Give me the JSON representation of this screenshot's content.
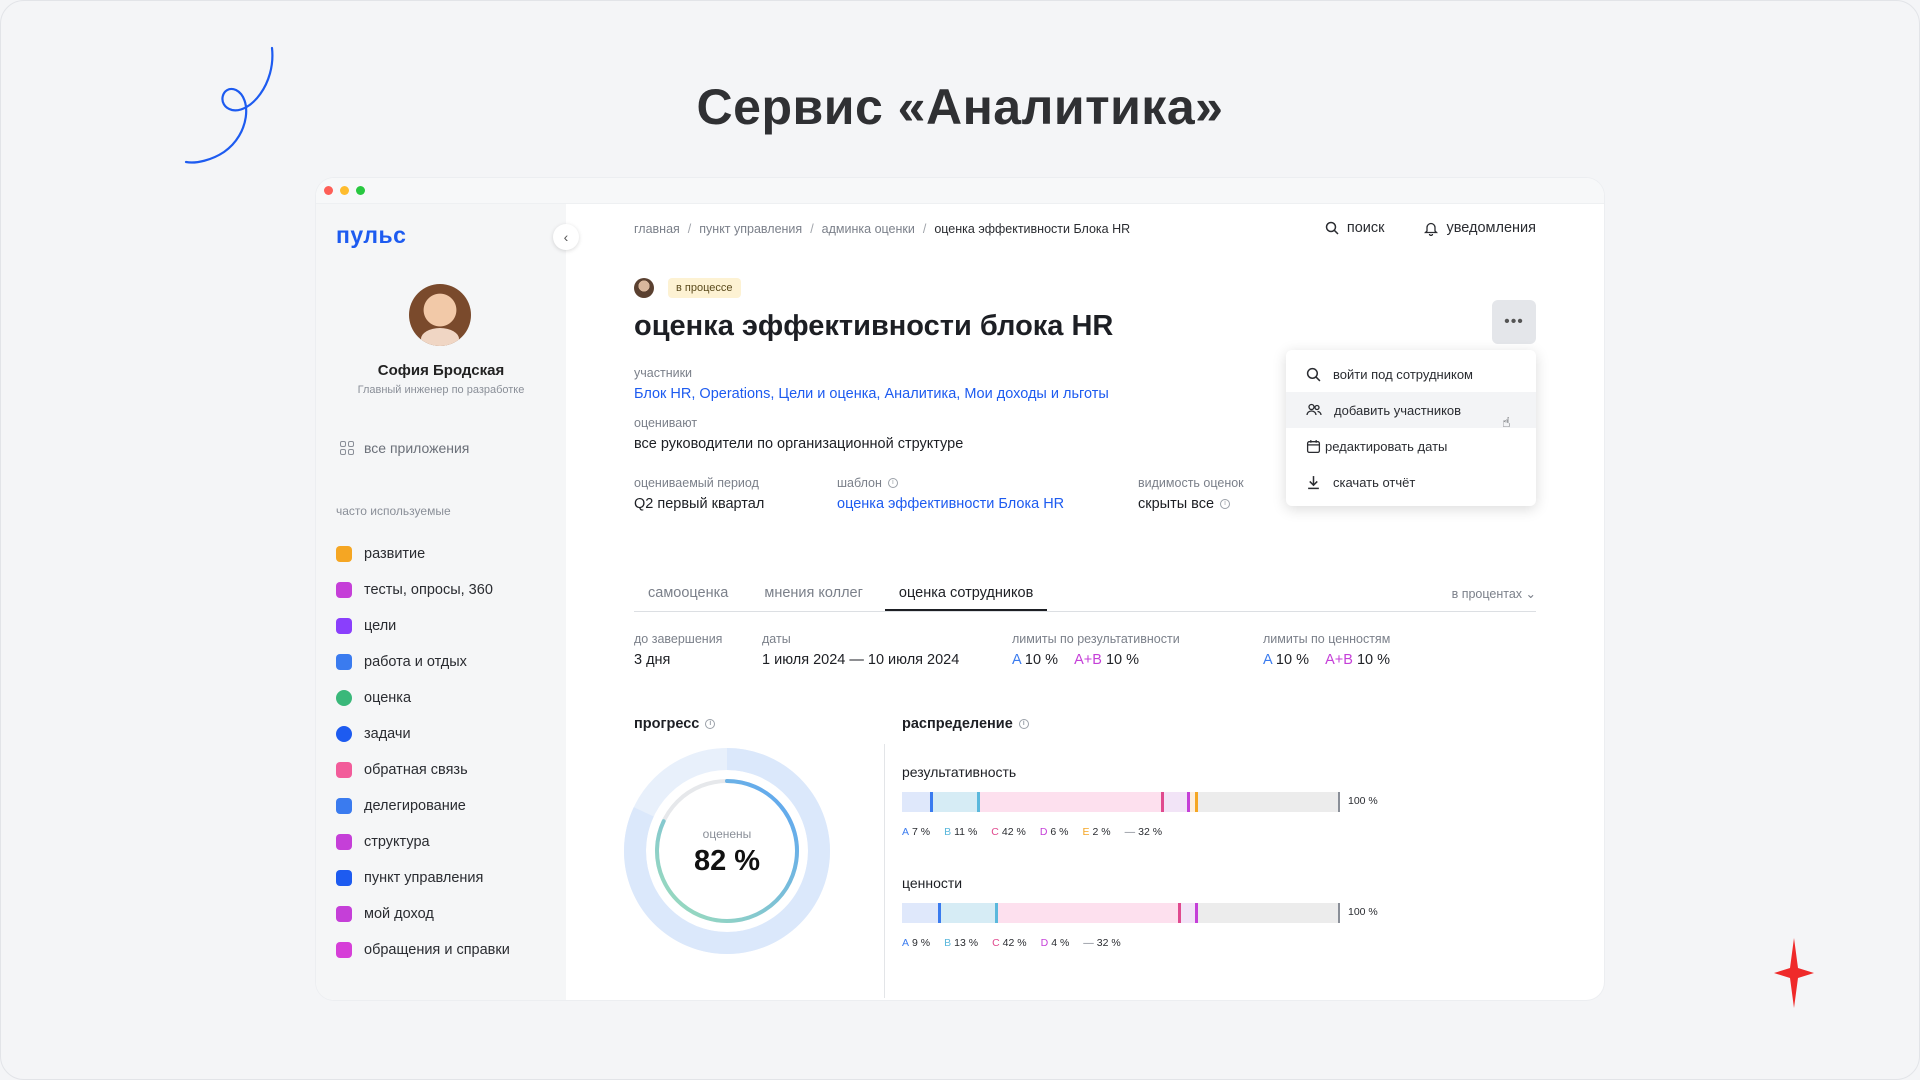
{
  "slide": {
    "title": "Сервис «Аналитика»"
  },
  "app": {
    "logo": "пульс",
    "user": {
      "name": "София Бродская",
      "role": "Главный инженер по разработке"
    },
    "all_apps": "все приложения",
    "frequent_label": "часто используемые",
    "nav": [
      {
        "label": "развитие",
        "icon": "book-icon",
        "color": "#f5a623"
      },
      {
        "label": "тесты, опросы, 360",
        "icon": "checkbox-icon",
        "color": "#c53fd8"
      },
      {
        "label": "цели",
        "icon": "flag-icon",
        "color": "#8a3ffc"
      },
      {
        "label": "работа и отдых",
        "icon": "chat-icon",
        "color": "#3a7bef"
      },
      {
        "label": "оценка",
        "icon": "star-circle-icon",
        "color": "#3ab87a"
      },
      {
        "label": "задачи",
        "icon": "target-icon",
        "color": "#1d5bf0"
      },
      {
        "label": "обратная связь",
        "icon": "feedback-icon",
        "color": "#f25c9a"
      },
      {
        "label": "делегирование",
        "icon": "people-icon",
        "color": "#3a7bef"
      },
      {
        "label": "структура",
        "icon": "structure-icon",
        "color": "#c53fd8"
      },
      {
        "label": "пункт управления",
        "icon": "wrench-icon",
        "color": "#1d5bf0"
      },
      {
        "label": "мой доход",
        "icon": "gem-icon",
        "color": "#c53fd8"
      },
      {
        "label": "обращения и справки",
        "icon": "document-icon",
        "color": "#d63fd8"
      }
    ]
  },
  "header": {
    "breadcrumb": [
      "главная",
      "пункт управления",
      "админка оценки",
      "оценка эффективности Блока HR"
    ],
    "search": "поиск",
    "notifications": "уведомления"
  },
  "page": {
    "status": "в процессе",
    "title": "оценка эффективности блока HR",
    "participants_label": "участники",
    "participants": "Блок HR, Operations, Цели и оценка, Аналитика, Мои доходы и льготы",
    "evaluators_label": "оценивают",
    "evaluators": "все руководители по организационной структуре",
    "period_label": "оцениваемый период",
    "period": "Q2 первый квартал",
    "template_label": "шаблон",
    "template": "оценка эффективности Блока HR",
    "visibility_label": "видимость оценок",
    "visibility": "скрыты все"
  },
  "menu": [
    {
      "label": "войти под сотрудником",
      "icon": "search-icon"
    },
    {
      "label": "добавить участников",
      "icon": "add-people-icon"
    },
    {
      "label": "редактировать даты",
      "icon": "calendar-icon"
    },
    {
      "label": "скачать отчёт",
      "icon": "download-icon"
    }
  ],
  "tabs": {
    "items": [
      "самооценка",
      "мнения коллег",
      "оценка сотрудников"
    ],
    "active": 2,
    "units": "в процентах"
  },
  "limits": {
    "remaining_label": "до завершения",
    "remaining": "3 дня",
    "dates_label": "даты",
    "dates": "1 июля 2024 — 10 июля 2024",
    "perf_label": "лимиты по результативности",
    "values_label": "лимиты по ценностям",
    "A_label": "A",
    "AB_label": "A+B",
    "perf_A": "10 %",
    "perf_AB": "10 %",
    "val_A": "10 %",
    "val_AB": "10 %"
  },
  "progress": {
    "heading": "прогресс",
    "caption": "оценены",
    "value_text": "82 %",
    "value": 82
  },
  "distribution": {
    "heading": "распределение",
    "total": "100 %",
    "colors": {
      "A": "#dfe8fb",
      "B": "#d6ecf5",
      "C": "#fde0ee",
      "D": "#f2e4f7",
      "E": "#fdeedd",
      "none": "#ececec"
    },
    "marks": {
      "A": "#3a7bef",
      "B": "#5bb8dc",
      "C": "#e04a8f",
      "D": "#c53fd8",
      "E": "#f5a623"
    },
    "groups": [
      {
        "name": "результативность",
        "segments": [
          {
            "key": "A",
            "label": "A",
            "text": "7 %",
            "value": 7
          },
          {
            "key": "B",
            "label": "B",
            "text": "11 %",
            "value": 11
          },
          {
            "key": "C",
            "label": "C",
            "text": "42 %",
            "value": 42
          },
          {
            "key": "D",
            "label": "D",
            "text": "6 %",
            "value": 6
          },
          {
            "key": "E",
            "label": "E",
            "text": "2 %",
            "value": 2
          },
          {
            "key": "none",
            "label": "—",
            "text": "32 %",
            "value": 32
          }
        ]
      },
      {
        "name": "ценности",
        "segments": [
          {
            "key": "A",
            "label": "A",
            "text": "9 %",
            "value": 9
          },
          {
            "key": "B",
            "label": "B",
            "text": "13 %",
            "value": 13
          },
          {
            "key": "C",
            "label": "C",
            "text": "42 %",
            "value": 42
          },
          {
            "key": "D",
            "label": "D",
            "text": "4 %",
            "value": 4
          },
          {
            "key": "none",
            "label": "—",
            "text": "32 %",
            "value": 32
          }
        ]
      }
    ]
  }
}
